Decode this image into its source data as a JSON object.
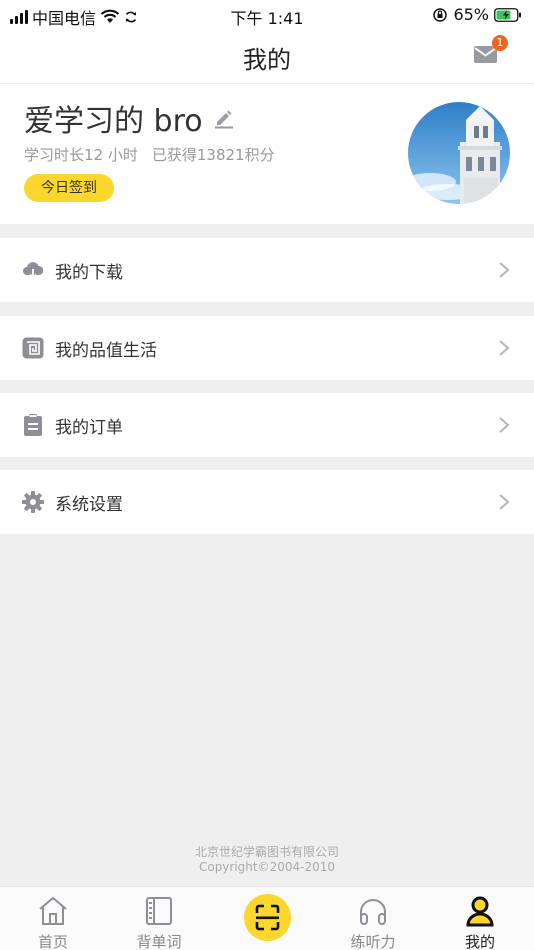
{
  "status_bar": {
    "carrier": "中国电信",
    "time": "下午 1:41",
    "battery": "65%"
  },
  "nav": {
    "title": "我的",
    "mail_badge": "1"
  },
  "profile": {
    "username": "爱学习的 bro",
    "study_time": "学习时长12 小时",
    "points": "已获得13821积分",
    "checkin_label": "今日签到"
  },
  "menu": [
    {
      "label": "我的下载",
      "icon": "cloud-download-icon"
    },
    {
      "label": "我的品值生活",
      "icon": "spiral-icon"
    },
    {
      "label": "我的订单",
      "icon": "clipboard-icon"
    },
    {
      "label": "系统设置",
      "icon": "gear-icon"
    }
  ],
  "footer": {
    "company": "北京世纪学霸图书有限公司",
    "copyright": "Copyright©2004-2010"
  },
  "tabs": [
    {
      "label": "首页",
      "icon": "home-icon"
    },
    {
      "label": "背单词",
      "icon": "book-icon"
    },
    {
      "label": "练听力",
      "icon": "headphones-icon"
    },
    {
      "label": "我的",
      "icon": "person-icon",
      "active": true
    }
  ],
  "colors": {
    "accent": "#fbd62c",
    "badge": "#f0651e",
    "muted": "#999999"
  }
}
